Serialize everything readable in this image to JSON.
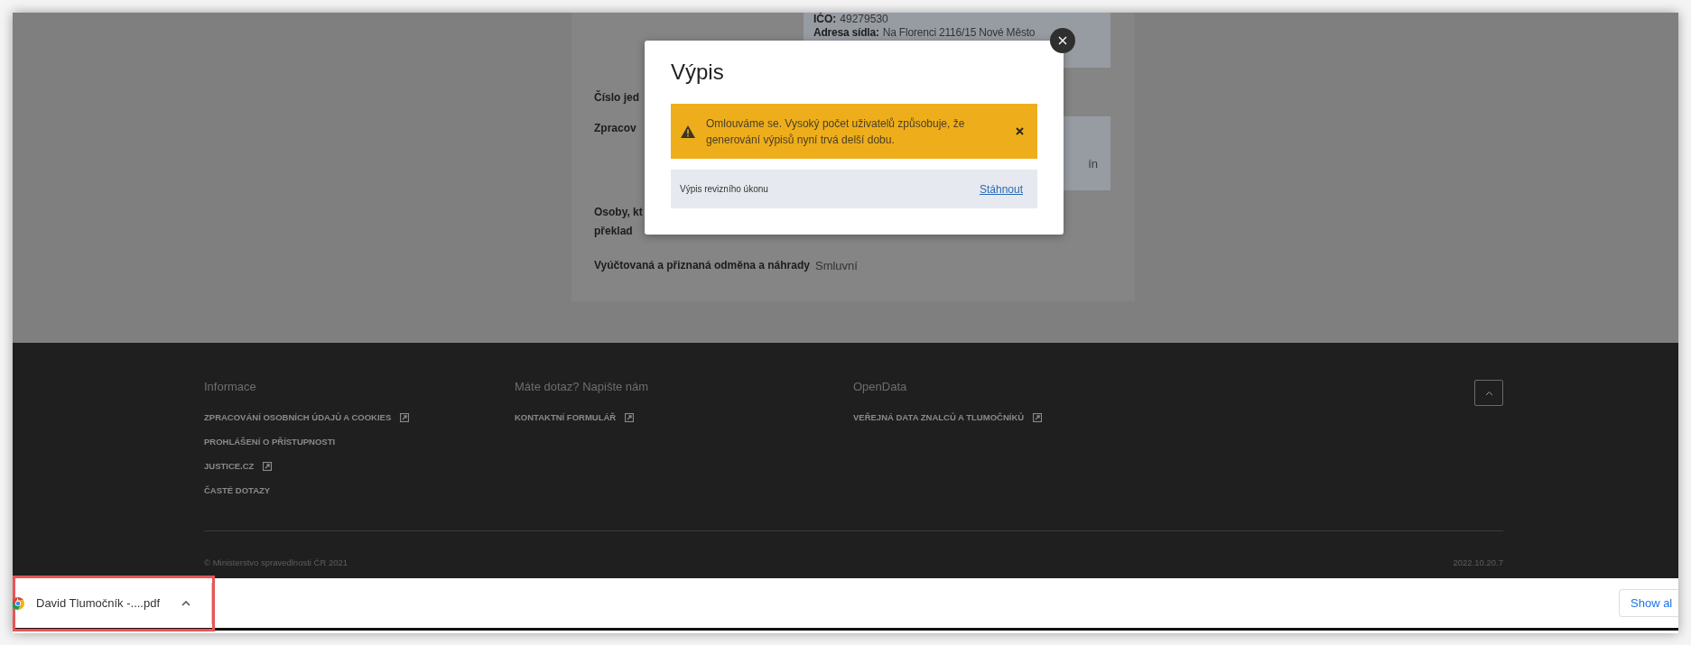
{
  "page": {
    "company_box": {
      "ico_label": "IČO:",
      "ico_value": "49279530",
      "address_label": "Adresa sídla:",
      "address_value": "Na Florenci 2116/15 Nové Město"
    },
    "rows": [
      {
        "kind": "label",
        "label": "Číslo jed"
      },
      {
        "kind": "boxed",
        "label": "Zpracov",
        "box_text": "ín"
      },
      {
        "kind": "multiline",
        "lines": [
          "Osoby, kt",
          "překlad"
        ]
      },
      {
        "kind": "value",
        "label": "Vyúčtovaná a přiznaná odměna a náhrady",
        "value": "Smluvní"
      }
    ]
  },
  "modal": {
    "title": "Výpis",
    "alert": {
      "text": "Omlouváme se. Vysoký počet uživatelů způsobuje, že generování výpisů nyní trvá delší dobu."
    },
    "download_row": {
      "label": "Výpis revizního úkonu",
      "link": "Stáhnout"
    }
  },
  "footer": {
    "columns": [
      {
        "heading": "Informace",
        "links": [
          {
            "label": "ZPRACOVÁNÍ OSOBNÍCH ÚDAJŮ A COOKIES",
            "external": true
          },
          {
            "label": "PROHLÁŠENÍ O PŘÍSTUPNOSTI",
            "external": false
          },
          {
            "label": "JUSTICE.CZ",
            "external": true
          },
          {
            "label": "ČASTÉ DOTAZY",
            "external": false
          }
        ]
      },
      {
        "heading": "Máte dotaz? Napište nám",
        "links": [
          {
            "label": "KONTAKTNÍ FORMULÁŘ",
            "external": true
          }
        ]
      },
      {
        "heading": "OpenData",
        "links": [
          {
            "label": "VEŘEJNÁ DATA ZNALCŮ A TLUMOČNÍKŮ",
            "external": true
          }
        ]
      }
    ],
    "copyright": "© Ministerstvo spravedlnosti ČR 2021",
    "version": "2022.10.20.7"
  },
  "download_bar": {
    "items": [
      {
        "filename": "David Tlumočník -....pdf",
        "highlighted": true
      }
    ],
    "show_all": "Show al"
  }
}
